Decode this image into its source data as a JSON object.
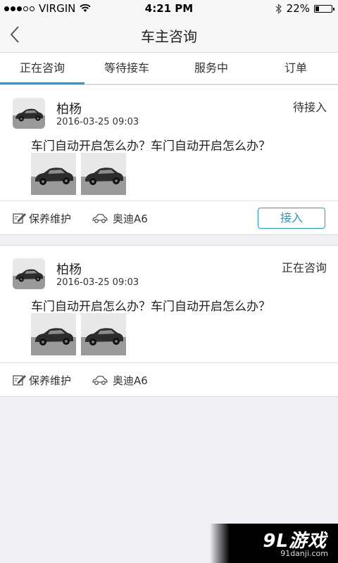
{
  "statusbar": {
    "carrier": "VIRGIN",
    "time": "4:21 PM",
    "battery_text": "22%",
    "battery_level": 0.22
  },
  "navbar": {
    "title": "车主咨询"
  },
  "tabs": [
    {
      "label": "正在咨询",
      "active": true
    },
    {
      "label": "等待接车",
      "active": false
    },
    {
      "label": "服务中",
      "active": false
    },
    {
      "label": "订单",
      "active": false
    }
  ],
  "cards": [
    {
      "name": "柏杨",
      "datetime": "2016-03-25 09:03",
      "status": "待接入",
      "question": "车门自动开启怎么办？车门自动开启怎么办？",
      "service": "保养维护",
      "car_model": "奥迪A6",
      "action_label": "接入"
    },
    {
      "name": "柏杨",
      "datetime": "2016-03-25 09:03",
      "status": "正在咨询",
      "question": "车门自动开启怎么办？车门自动开启怎么办？",
      "service": "保养维护",
      "car_model": "奥迪A6"
    }
  ],
  "watermark": {
    "logo": "9L游戏",
    "site": "91danji.com"
  },
  "colors": {
    "accent": "#1e9bd8",
    "background": "#efeff4"
  }
}
